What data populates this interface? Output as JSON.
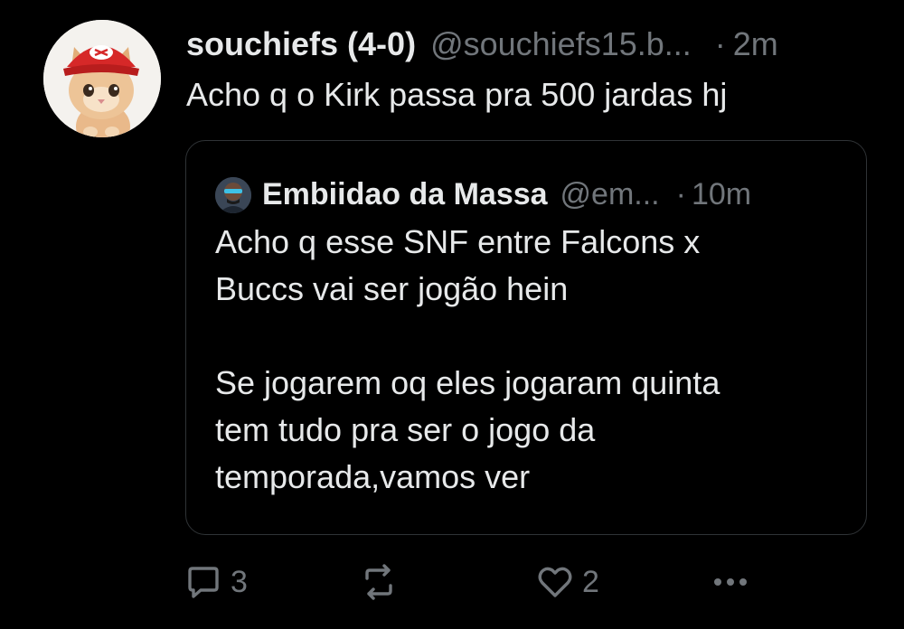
{
  "tweet": {
    "display_name": "souchiefs (4-0)",
    "handle": "@souchiefs15.b...",
    "separator": "·",
    "time": "2m",
    "text": "Acho q o Kirk passa pra 500 jardas hj",
    "avatar_icon": "kitten-in-red-chiefs-cap"
  },
  "quote": {
    "display_name": "Embiidao da Massa",
    "handle": "@em...",
    "separator": "·",
    "time": "10m",
    "avatar_icon": "person-with-sunglasses",
    "text_lines": [
      "Acho q esse SNF entre Falcons x",
      "Buccs vai ser jogão hein",
      "",
      "Se jogarem oq eles jogaram quinta",
      "tem tudo pra ser o jogo da",
      "temporada,vamos ver"
    ]
  },
  "actions": {
    "reply": {
      "icon": "reply-icon",
      "count": "3"
    },
    "retweet": {
      "icon": "retweet-icon"
    },
    "like": {
      "icon": "like-icon",
      "count": "2"
    },
    "more": {
      "icon": "more-icon"
    }
  },
  "colors": {
    "background": "#000000",
    "primary_text": "#e7e9ea",
    "secondary_text": "#71767b",
    "border": "#2f3336",
    "cap_red": "#d62828"
  }
}
